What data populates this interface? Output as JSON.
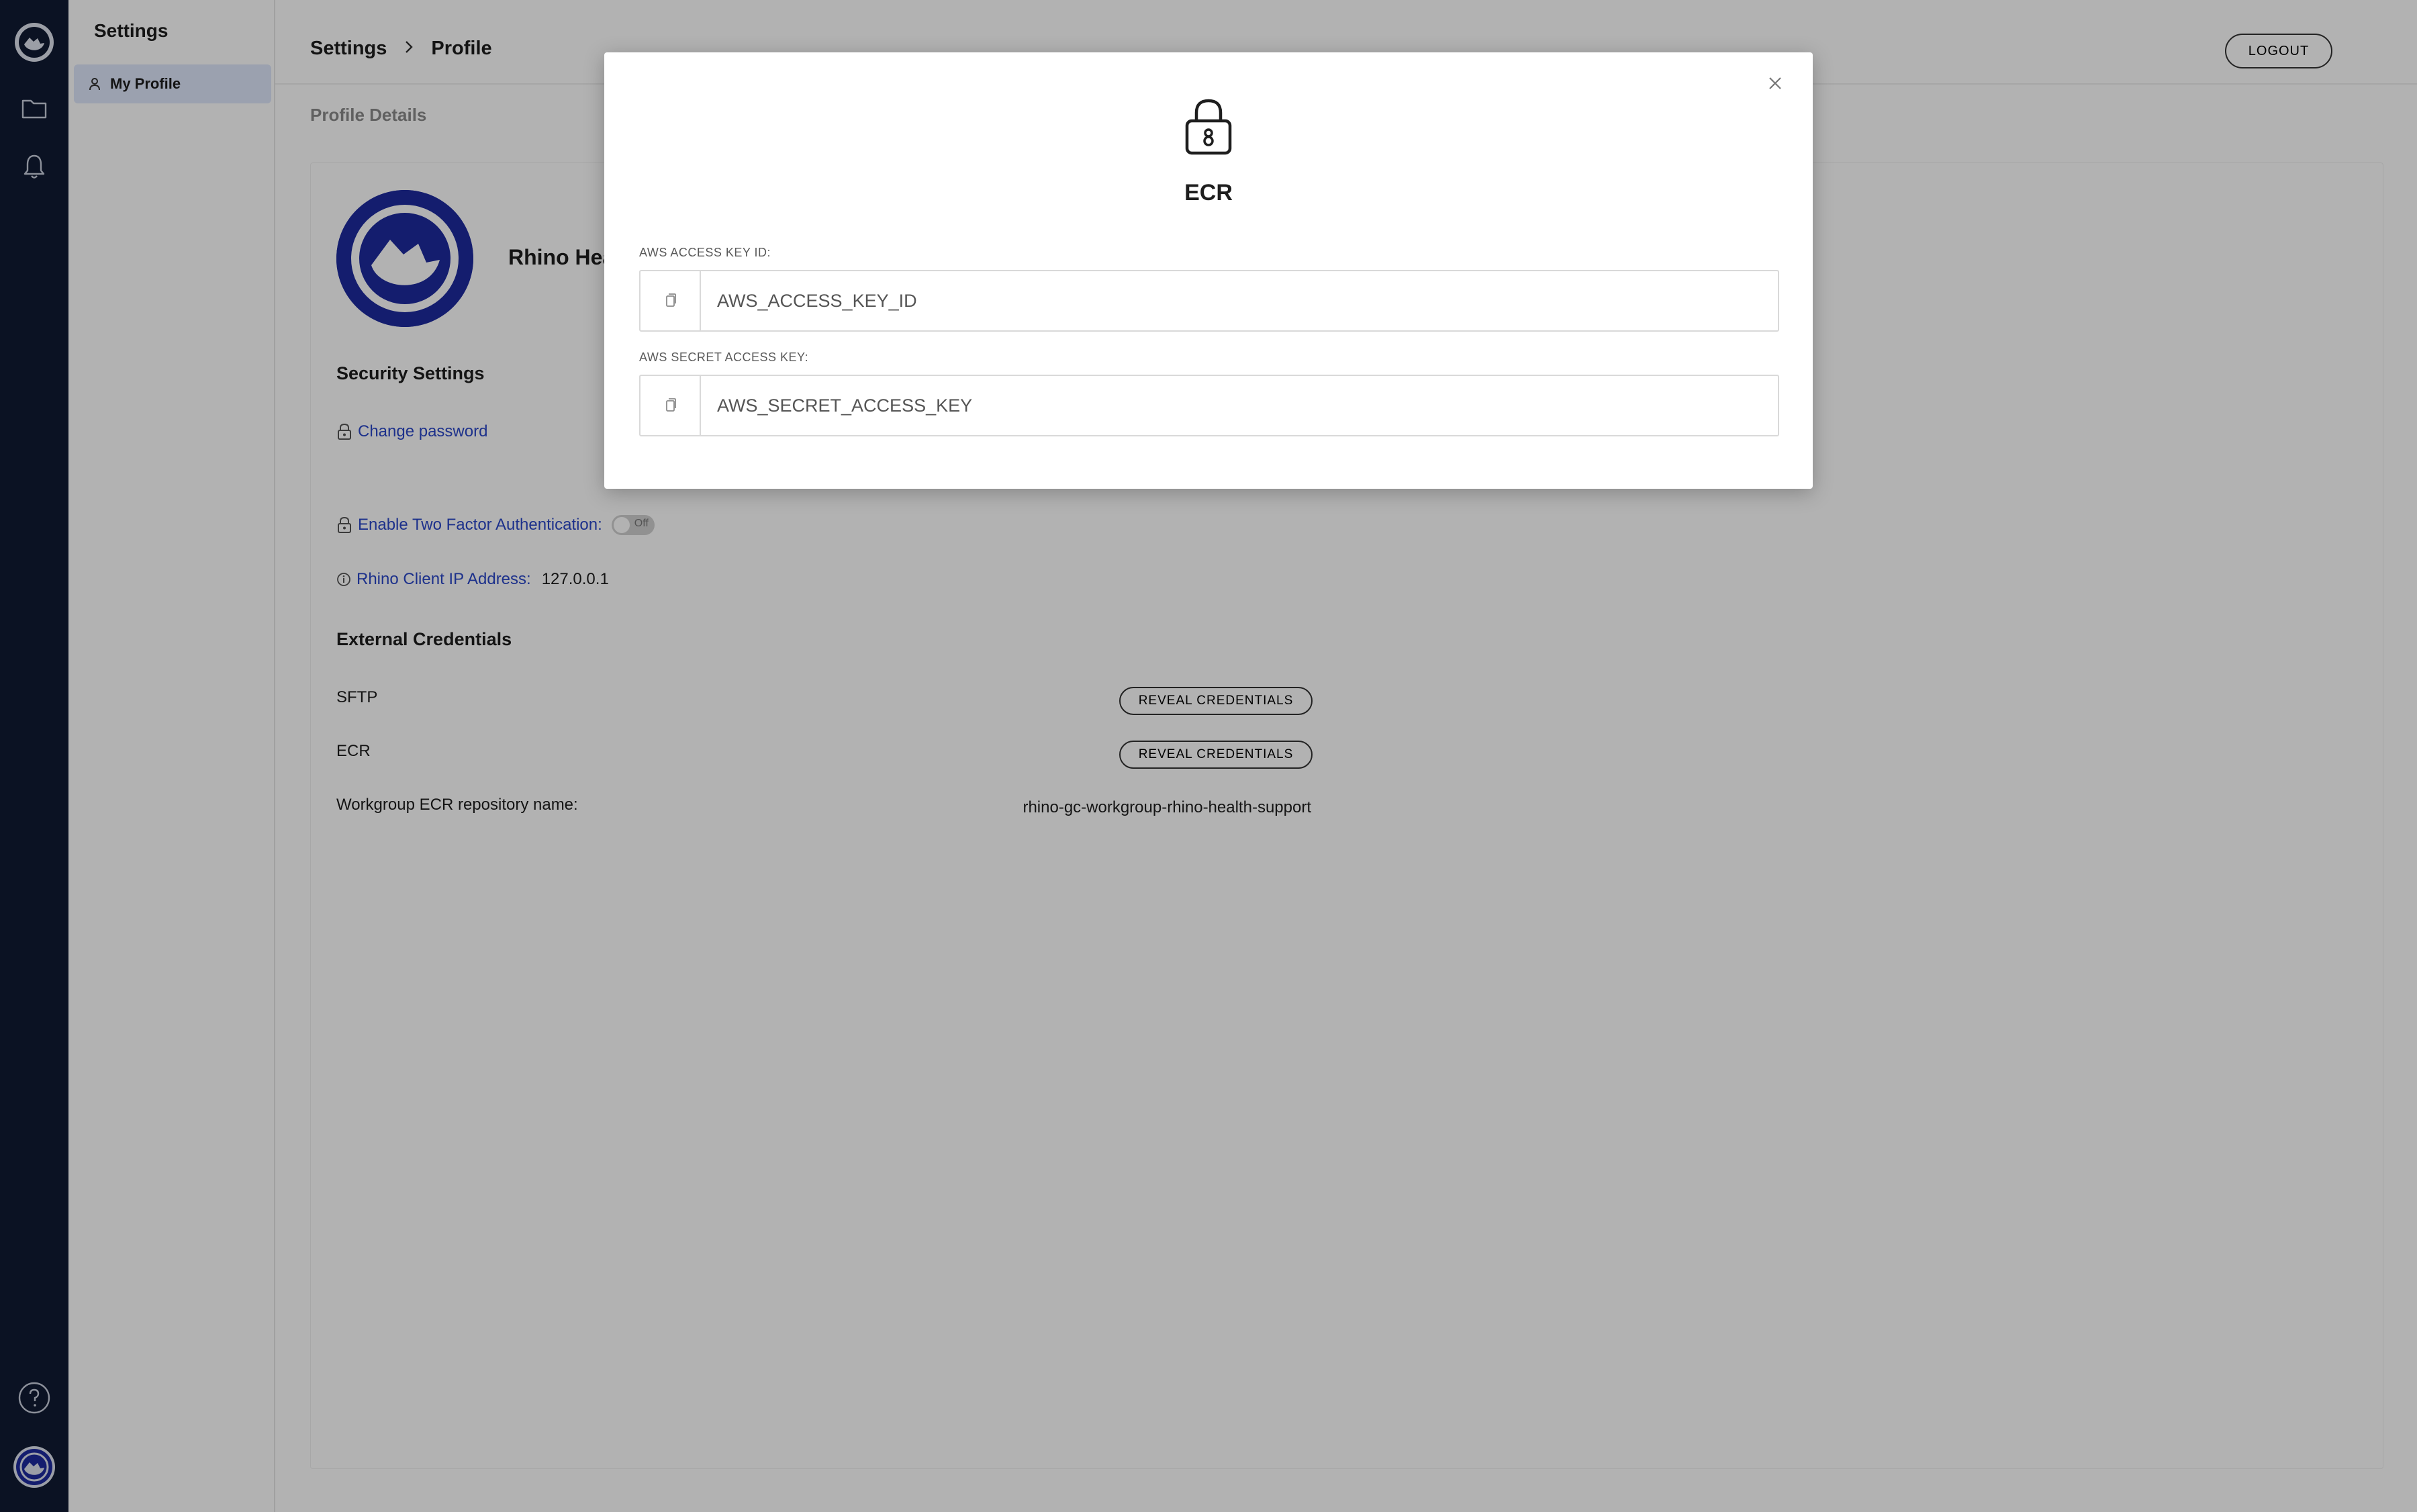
{
  "subnav": {
    "title": "Settings",
    "items": [
      {
        "label": "My Profile",
        "icon": "person-icon"
      }
    ]
  },
  "header": {
    "breadcrumb": [
      "Settings",
      "Profile"
    ],
    "logout_label": "LOGOUT"
  },
  "profile": {
    "section_label": "Profile Details",
    "org_name": "Rhino Health",
    "security_title": "Security Settings",
    "change_password": "Change password",
    "two_factor_label": "Enable Two Factor Authentication:",
    "two_factor_state": "Off",
    "ip_label": "Rhino Client IP Address:",
    "ip_value": "127.0.0.1",
    "external_title": "External Credentials",
    "sftp_label": "SFTP",
    "ecr_label": "ECR",
    "reveal_label": "REVEAL CREDENTIALS",
    "repo_label": "Workgroup ECR repository name:",
    "repo_value": "rhino-gc-workgroup-rhino-health-support"
  },
  "modal": {
    "title": "ECR",
    "access_key_label": "AWS ACCESS KEY ID:",
    "access_key_value": "AWS_ACCESS_KEY_ID",
    "secret_key_label": "AWS SECRET ACCESS KEY:",
    "secret_key_value": "AWS_SECRET_ACCESS_KEY"
  },
  "colors": {
    "rail": "#111a33",
    "accent": "#2a47c8",
    "brand": "#1d2a9e",
    "nav_active": "#dfe7fb"
  }
}
